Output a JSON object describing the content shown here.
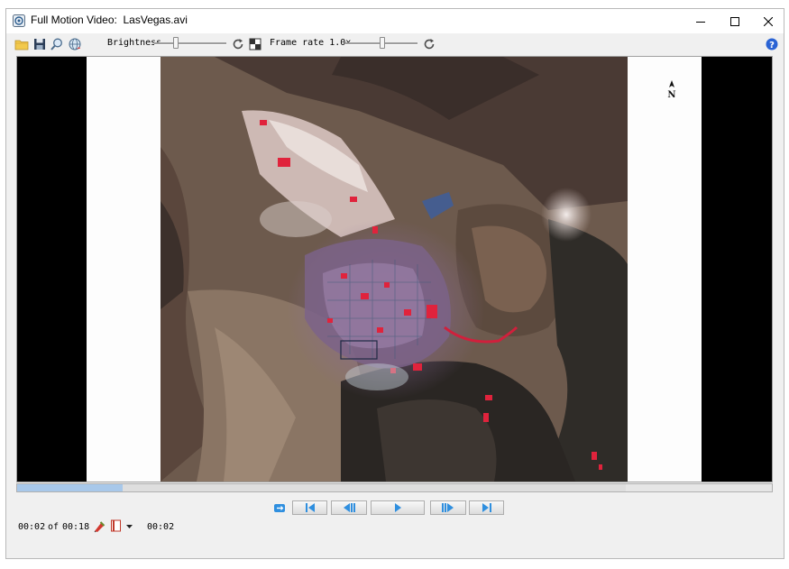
{
  "window": {
    "title": "Full Motion Video:  LasVegas.avi",
    "controls": [
      "minimize-icon",
      "maximize-icon",
      "close-icon"
    ]
  },
  "toolbar": {
    "icons": [
      "open-folder-icon",
      "save-icon",
      "zoom-icon",
      "globe-icon"
    ],
    "brightness_label": "Brightness",
    "brightness_level": 0.28,
    "frame_rate_label": "Frame rate 1.0x",
    "frame_rate_level": 0.52,
    "help_icon": "help-icon"
  },
  "video": {
    "north_label": "N"
  },
  "playback": {
    "progress_fraction": 0.14,
    "buttons": [
      "loop-icon",
      "first-frame-icon",
      "step-back-icon",
      "play-icon",
      "step-forward-icon",
      "last-frame-icon"
    ]
  },
  "status": {
    "current_time": "00:02",
    "of_label": "of",
    "total_time": "00:18",
    "marker_time": "00:02"
  },
  "colors": {
    "accent": "#2f8fdf",
    "progress_fill": "#a8c8ea",
    "urban_red": "#e0233c"
  }
}
